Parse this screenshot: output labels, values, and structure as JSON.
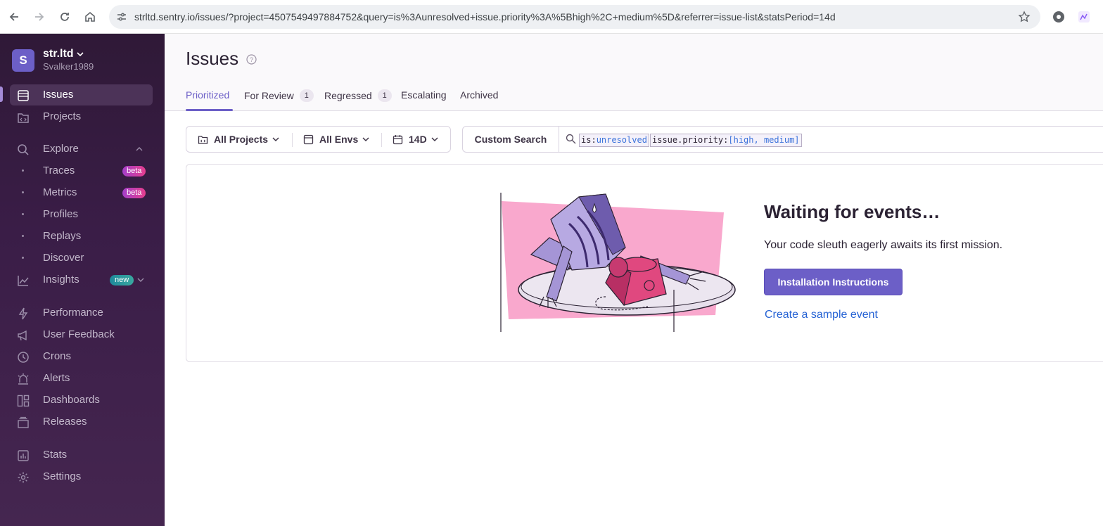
{
  "browser": {
    "url": "strltd.sentry.io/issues/?project=4507549497884752&query=is%3Aunresolved+issue.priority%3A%5Bhigh%2C+medium%5D&referrer=issue-list&statsPeriod=14d",
    "icons": [
      "back-arrow-icon",
      "forward-arrow-icon",
      "reload-icon",
      "home-icon",
      "site-settings-icon",
      "bookmark-star-icon",
      "extensions-icon",
      "profile-icon"
    ]
  },
  "org": {
    "avatar_letter": "S",
    "name": "str.ltd",
    "user": "Svalker1989"
  },
  "sidebar": {
    "items": [
      {
        "label": "Issues",
        "icon": "issues-icon"
      },
      {
        "label": "Projects",
        "icon": "projects-icon"
      },
      {
        "label": "Explore",
        "icon": "search-icon"
      },
      {
        "label": "Traces",
        "badge": "beta"
      },
      {
        "label": "Metrics",
        "badge": "beta"
      },
      {
        "label": "Profiles"
      },
      {
        "label": "Replays"
      },
      {
        "label": "Discover"
      },
      {
        "label": "Insights",
        "icon": "insights-icon",
        "badge": "new"
      },
      {
        "label": "Performance",
        "icon": "performance-icon"
      },
      {
        "label": "User Feedback",
        "icon": "megaphone-icon"
      },
      {
        "label": "Crons",
        "icon": "clock-icon"
      },
      {
        "label": "Alerts",
        "icon": "siren-icon"
      },
      {
        "label": "Dashboards",
        "icon": "dashboard-icon"
      },
      {
        "label": "Releases",
        "icon": "releases-icon"
      },
      {
        "label": "Stats",
        "icon": "stats-icon"
      },
      {
        "label": "Settings",
        "icon": "gear-icon"
      }
    ]
  },
  "header": {
    "title": "Issues",
    "tabs": [
      {
        "label": "Prioritized"
      },
      {
        "label": "For Review",
        "count": "1"
      },
      {
        "label": "Regressed",
        "count": "1"
      },
      {
        "label": "Escalating"
      },
      {
        "label": "Archived"
      }
    ]
  },
  "filters": {
    "projects": "All Projects",
    "envs": "All Envs",
    "period": "14D"
  },
  "search": {
    "custom_label": "Custom Search",
    "tokens": [
      {
        "key": "is:",
        "value": "unresolved"
      },
      {
        "key": "issue.priority:",
        "value": "[high, medium]"
      }
    ]
  },
  "empty_state": {
    "title": "Waiting for events…",
    "description": "Your code sleuth eagerly awaits its first mission.",
    "install_button": "Installation Instructions",
    "sample_link": "Create a sample event"
  },
  "colors": {
    "accent": "#6c5fc7",
    "sidebar_bg": "#3a1d47",
    "link": "#2562d4"
  }
}
